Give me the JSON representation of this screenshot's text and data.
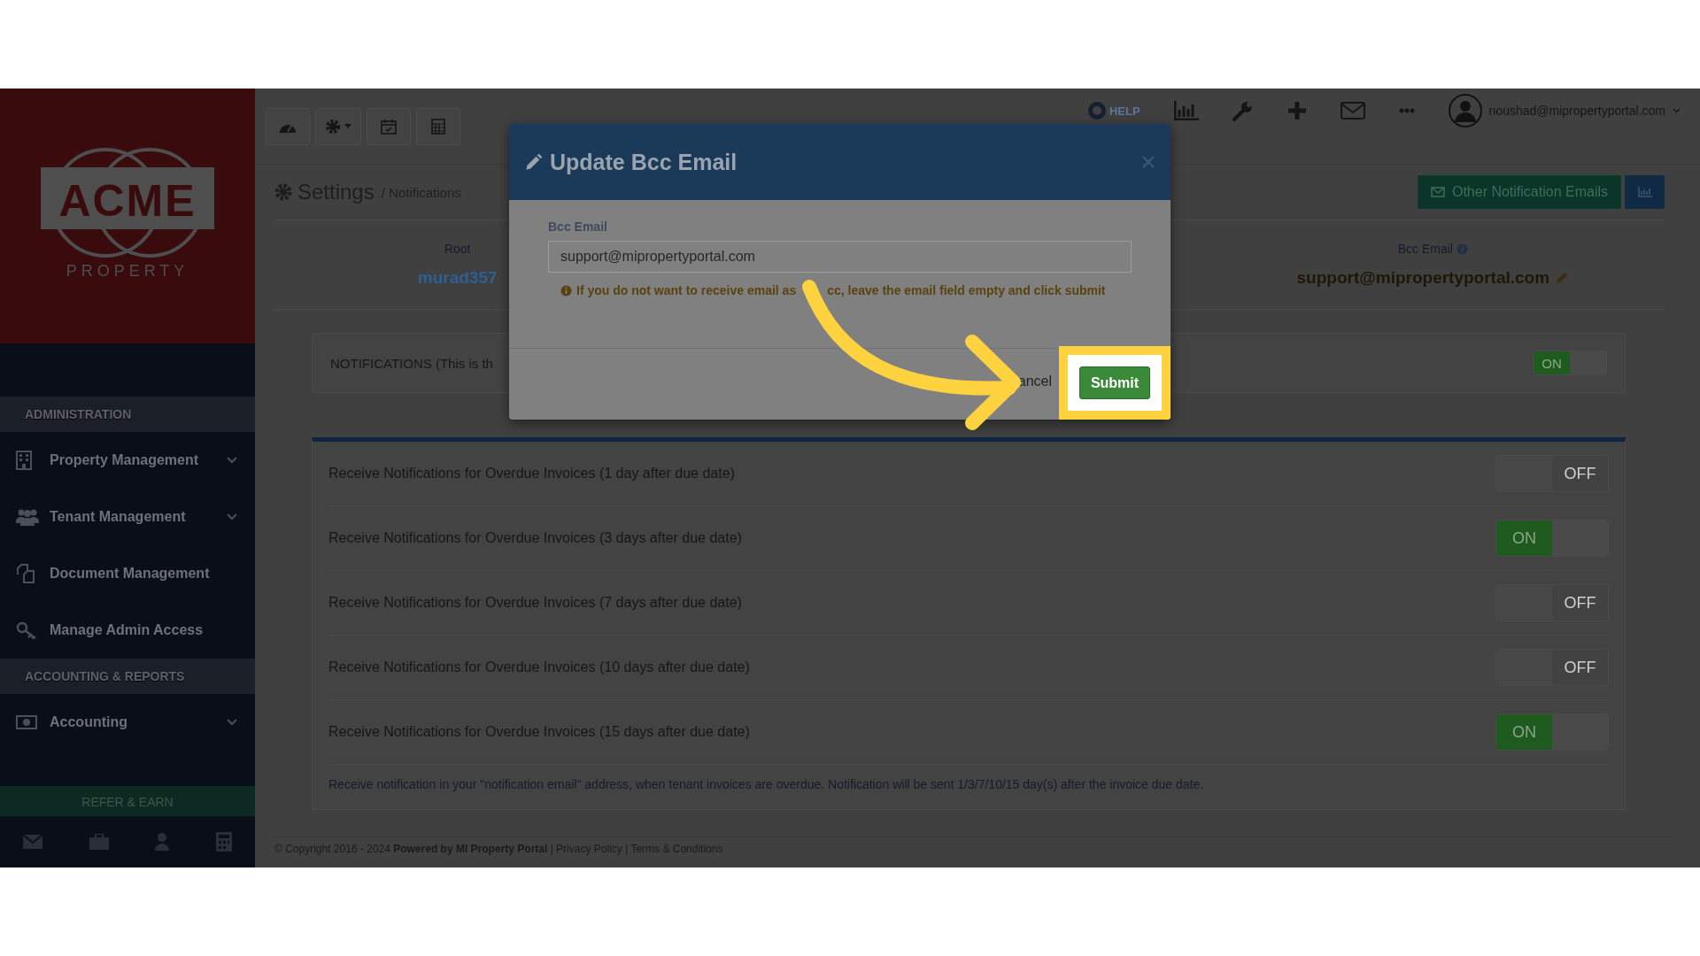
{
  "sidebar": {
    "logo": {
      "wordmark": "ACME",
      "subtitle": "PROPERTY"
    },
    "sections": [
      {
        "heading": "ADMINISTRATION",
        "items": [
          {
            "label": "Property Management",
            "expandable": true
          },
          {
            "label": "Tenant Management",
            "expandable": true
          },
          {
            "label": "Document Management",
            "expandable": false
          },
          {
            "label": "Manage Admin Access",
            "expandable": false
          }
        ]
      },
      {
        "heading": "ACCOUNTING & REPORTS",
        "items": [
          {
            "label": "Accounting",
            "expandable": true
          }
        ]
      }
    ],
    "refer_button": "REFER & EARN"
  },
  "topbar": {
    "help": "HELP",
    "user_email": "noushad@mipropertyportal.com"
  },
  "header": {
    "title": "Settings",
    "breadcrumb": "/ Notifications",
    "other_emails_button": "Other Notification Emails"
  },
  "info": {
    "root_label": "Root",
    "root_value": "murad357",
    "bcc_label": "Bcc Email",
    "bcc_value": "support@mipropertyportal.com"
  },
  "master": {
    "label": "NOTIFICATIONS (This is th",
    "on": true,
    "toggle_text": "ON"
  },
  "rows": [
    {
      "label": "Receive Notifications for Overdue Invoices (1 day after due date)",
      "on": false,
      "toggle_text": "OFF"
    },
    {
      "label": "Receive Notifications for Overdue Invoices (3 days after due date)",
      "on": true,
      "toggle_text": "ON"
    },
    {
      "label": "Receive Notifications for Overdue Invoices (7 days after due date)",
      "on": false,
      "toggle_text": "OFF"
    },
    {
      "label": "Receive Notifications for Overdue Invoices (10 days after due date)",
      "on": false,
      "toggle_text": "OFF"
    },
    {
      "label": "Receive Notifications for Overdue Invoices (15 days after due date)",
      "on": true,
      "toggle_text": "ON"
    }
  ],
  "note": "Receive notification in your \"notification email\" address, when tenant invoices are overdue. Notification will be sent 1/3/7/10/15 day(s) after the invoice due date.",
  "footer": {
    "text": "© Copyright 2016 - 2024 **Powered by MI Property Portal**",
    "separator": "|",
    "links": [
      "Privacy Policy",
      "Terms & Conditions"
    ]
  },
  "modal": {
    "title": "Update Bcc Email",
    "field_label": "Bcc Email",
    "value": "support@mipropertyportal.com",
    "hint_start": "If you do not want to receive email as",
    "hint_end": "cc, leave the email field empty and click submit",
    "cancel": "ancel",
    "submit": "Submit"
  }
}
